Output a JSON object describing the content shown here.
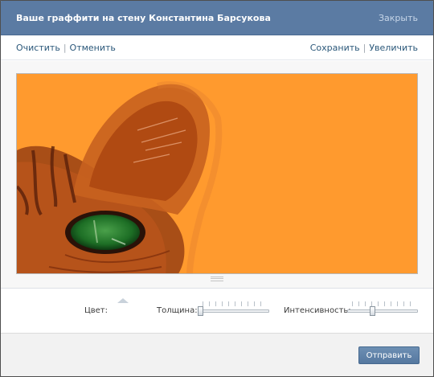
{
  "dialog": {
    "title": "Ваше граффити на стену Константина Барсукова",
    "close_label": "Закрыть"
  },
  "toolbar": {
    "clear_label": "Очистить",
    "undo_label": "Отменить",
    "save_label": "Сохранить",
    "zoom_label": "Увеличить"
  },
  "canvas": {
    "background_color": "#ff9a2e"
  },
  "controls": {
    "color_label": "Цвет:",
    "thickness_label": "Толщина:",
    "thickness_level": 0.0,
    "intensity_label": "Интенсивность:",
    "intensity_level": 0.35
  },
  "footer": {
    "send_label": "Отправить"
  },
  "colors": {
    "accent": "#5b7ba3",
    "link": "#2b587a"
  }
}
